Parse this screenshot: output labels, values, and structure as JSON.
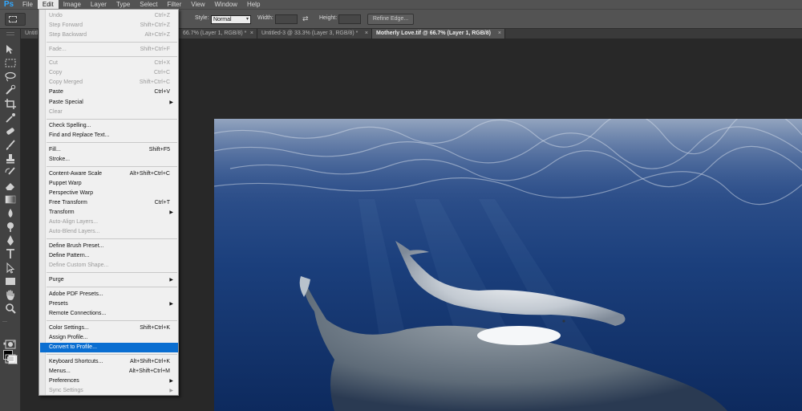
{
  "app": {
    "logo": "Ps",
    "menubar": [
      "File",
      "Edit",
      "Image",
      "Layer",
      "Type",
      "Select",
      "Filter",
      "View",
      "Window",
      "Help"
    ],
    "active_menu": "Edit"
  },
  "options_bar": {
    "style_label": "Style:",
    "style_value": "Normal",
    "width_label": "Width:",
    "height_label": "Height:",
    "refine_button": "Refine Edge..."
  },
  "tabs": [
    {
      "label": "Untitl",
      "close": "",
      "active": false
    },
    {
      "label": "66.7% (Layer 1, RGB/8) *",
      "close": "×",
      "active": false
    },
    {
      "label": "Untitled-3 @ 33.3% (Layer 3, RGB/8) *",
      "close": "×",
      "active": false
    },
    {
      "label": "Motherly Love.tif @ 66.7% (Layer 1, RGB/8)",
      "close": "×",
      "active": true
    }
  ],
  "edit_menu": {
    "items": [
      {
        "label": "Undo",
        "shortcut": "Ctrl+Z",
        "disabled": true
      },
      {
        "label": "Step Forward",
        "shortcut": "Shift+Ctrl+Z",
        "disabled": true
      },
      {
        "label": "Step Backward",
        "shortcut": "Alt+Ctrl+Z",
        "disabled": true
      },
      {
        "label": "Fade...",
        "shortcut": "Shift+Ctrl+F",
        "disabled": true
      },
      {
        "label": "Cut",
        "shortcut": "Ctrl+X",
        "disabled": true
      },
      {
        "label": "Copy",
        "shortcut": "Ctrl+C",
        "disabled": true
      },
      {
        "label": "Copy Merged",
        "shortcut": "Shift+Ctrl+C",
        "disabled": true
      },
      {
        "label": "Paste",
        "shortcut": "Ctrl+V",
        "disabled": false
      },
      {
        "label": "Paste Special",
        "shortcut": "",
        "disabled": false,
        "submenu": true
      },
      {
        "label": "Clear",
        "shortcut": "",
        "disabled": true
      },
      {
        "label": "Check Spelling...",
        "shortcut": "",
        "disabled": false
      },
      {
        "label": "Find and Replace Text...",
        "shortcut": "",
        "disabled": false
      },
      {
        "label": "Fill...",
        "shortcut": "Shift+F5",
        "disabled": false
      },
      {
        "label": "Stroke...",
        "shortcut": "",
        "disabled": false
      },
      {
        "label": "Content-Aware Scale",
        "shortcut": "Alt+Shift+Ctrl+C",
        "disabled": false
      },
      {
        "label": "Puppet Warp",
        "shortcut": "",
        "disabled": false
      },
      {
        "label": "Perspective Warp",
        "shortcut": "",
        "disabled": false
      },
      {
        "label": "Free Transform",
        "shortcut": "Ctrl+T",
        "disabled": false
      },
      {
        "label": "Transform",
        "shortcut": "",
        "disabled": false,
        "submenu": true
      },
      {
        "label": "Auto-Align Layers...",
        "shortcut": "",
        "disabled": true
      },
      {
        "label": "Auto-Blend Layers...",
        "shortcut": "",
        "disabled": true
      },
      {
        "label": "Define Brush Preset...",
        "shortcut": "",
        "disabled": false
      },
      {
        "label": "Define Pattern...",
        "shortcut": "",
        "disabled": false
      },
      {
        "label": "Define Custom Shape...",
        "shortcut": "",
        "disabled": true
      },
      {
        "label": "Purge",
        "shortcut": "",
        "disabled": false,
        "submenu": true
      },
      {
        "label": "Adobe PDF Presets...",
        "shortcut": "",
        "disabled": false
      },
      {
        "label": "Presets",
        "shortcut": "",
        "disabled": false,
        "submenu": true
      },
      {
        "label": "Remote Connections...",
        "shortcut": "",
        "disabled": false
      },
      {
        "label": "Color Settings...",
        "shortcut": "Shift+Ctrl+K",
        "disabled": false
      },
      {
        "label": "Assign Profile...",
        "shortcut": "",
        "disabled": false
      },
      {
        "label": "Convert to Profile...",
        "shortcut": "",
        "disabled": false,
        "highlighted": true
      },
      {
        "label": "Keyboard Shortcuts...",
        "shortcut": "Alt+Shift+Ctrl+K",
        "disabled": false
      },
      {
        "label": "Menus...",
        "shortcut": "Alt+Shift+Ctrl+M",
        "disabled": false
      },
      {
        "label": "Preferences",
        "shortcut": "",
        "disabled": false,
        "submenu": true
      },
      {
        "label": "Sync Settings",
        "shortcut": "",
        "disabled": true,
        "submenu": true
      }
    ]
  },
  "toolbox": {
    "tools": [
      "move-tool-icon",
      "marquee-tool-icon",
      "lasso-tool-icon",
      "quick-selection-tool-icon",
      "crop-tool-icon",
      "eyedropper-tool-icon",
      "healing-brush-tool-icon",
      "brush-tool-icon",
      "clone-stamp-tool-icon",
      "history-brush-tool-icon",
      "eraser-tool-icon",
      "gradient-tool-icon",
      "blur-tool-icon",
      "dodge-tool-icon",
      "pen-tool-icon",
      "type-tool-icon",
      "path-selection-tool-icon",
      "rectangle-tool-icon",
      "hand-tool-icon",
      "zoom-tool-icon"
    ],
    "foreground_color": "#000000",
    "background_color": "#ffffff"
  },
  "photo": {
    "water_deep": "#0e2a5c",
    "water_surface": "#4b6ea6",
    "whale_color": "#c8cdd0"
  }
}
